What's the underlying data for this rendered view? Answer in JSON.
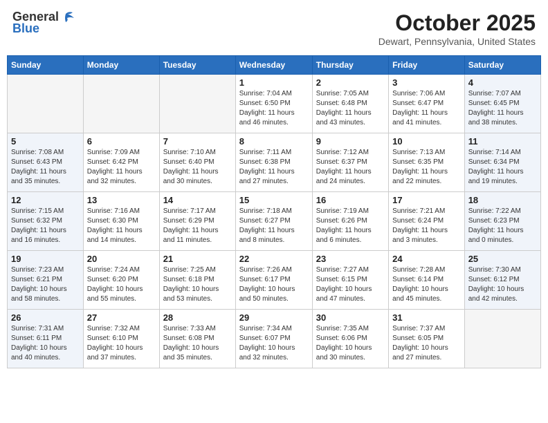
{
  "header": {
    "logo_general": "General",
    "logo_blue": "Blue",
    "month_title": "October 2025",
    "location": "Dewart, Pennsylvania, United States"
  },
  "days_of_week": [
    "Sunday",
    "Monday",
    "Tuesday",
    "Wednesday",
    "Thursday",
    "Friday",
    "Saturday"
  ],
  "weeks": [
    [
      {
        "day": "",
        "info": ""
      },
      {
        "day": "",
        "info": ""
      },
      {
        "day": "",
        "info": ""
      },
      {
        "day": "1",
        "info": "Sunrise: 7:04 AM\nSunset: 6:50 PM\nDaylight: 11 hours\nand 46 minutes."
      },
      {
        "day": "2",
        "info": "Sunrise: 7:05 AM\nSunset: 6:48 PM\nDaylight: 11 hours\nand 43 minutes."
      },
      {
        "day": "3",
        "info": "Sunrise: 7:06 AM\nSunset: 6:47 PM\nDaylight: 11 hours\nand 41 minutes."
      },
      {
        "day": "4",
        "info": "Sunrise: 7:07 AM\nSunset: 6:45 PM\nDaylight: 11 hours\nand 38 minutes."
      }
    ],
    [
      {
        "day": "5",
        "info": "Sunrise: 7:08 AM\nSunset: 6:43 PM\nDaylight: 11 hours\nand 35 minutes."
      },
      {
        "day": "6",
        "info": "Sunrise: 7:09 AM\nSunset: 6:42 PM\nDaylight: 11 hours\nand 32 minutes."
      },
      {
        "day": "7",
        "info": "Sunrise: 7:10 AM\nSunset: 6:40 PM\nDaylight: 11 hours\nand 30 minutes."
      },
      {
        "day": "8",
        "info": "Sunrise: 7:11 AM\nSunset: 6:38 PM\nDaylight: 11 hours\nand 27 minutes."
      },
      {
        "day": "9",
        "info": "Sunrise: 7:12 AM\nSunset: 6:37 PM\nDaylight: 11 hours\nand 24 minutes."
      },
      {
        "day": "10",
        "info": "Sunrise: 7:13 AM\nSunset: 6:35 PM\nDaylight: 11 hours\nand 22 minutes."
      },
      {
        "day": "11",
        "info": "Sunrise: 7:14 AM\nSunset: 6:34 PM\nDaylight: 11 hours\nand 19 minutes."
      }
    ],
    [
      {
        "day": "12",
        "info": "Sunrise: 7:15 AM\nSunset: 6:32 PM\nDaylight: 11 hours\nand 16 minutes."
      },
      {
        "day": "13",
        "info": "Sunrise: 7:16 AM\nSunset: 6:30 PM\nDaylight: 11 hours\nand 14 minutes."
      },
      {
        "day": "14",
        "info": "Sunrise: 7:17 AM\nSunset: 6:29 PM\nDaylight: 11 hours\nand 11 minutes."
      },
      {
        "day": "15",
        "info": "Sunrise: 7:18 AM\nSunset: 6:27 PM\nDaylight: 11 hours\nand 8 minutes."
      },
      {
        "day": "16",
        "info": "Sunrise: 7:19 AM\nSunset: 6:26 PM\nDaylight: 11 hours\nand 6 minutes."
      },
      {
        "day": "17",
        "info": "Sunrise: 7:21 AM\nSunset: 6:24 PM\nDaylight: 11 hours\nand 3 minutes."
      },
      {
        "day": "18",
        "info": "Sunrise: 7:22 AM\nSunset: 6:23 PM\nDaylight: 11 hours\nand 0 minutes."
      }
    ],
    [
      {
        "day": "19",
        "info": "Sunrise: 7:23 AM\nSunset: 6:21 PM\nDaylight: 10 hours\nand 58 minutes."
      },
      {
        "day": "20",
        "info": "Sunrise: 7:24 AM\nSunset: 6:20 PM\nDaylight: 10 hours\nand 55 minutes."
      },
      {
        "day": "21",
        "info": "Sunrise: 7:25 AM\nSunset: 6:18 PM\nDaylight: 10 hours\nand 53 minutes."
      },
      {
        "day": "22",
        "info": "Sunrise: 7:26 AM\nSunset: 6:17 PM\nDaylight: 10 hours\nand 50 minutes."
      },
      {
        "day": "23",
        "info": "Sunrise: 7:27 AM\nSunset: 6:15 PM\nDaylight: 10 hours\nand 47 minutes."
      },
      {
        "day": "24",
        "info": "Sunrise: 7:28 AM\nSunset: 6:14 PM\nDaylight: 10 hours\nand 45 minutes."
      },
      {
        "day": "25",
        "info": "Sunrise: 7:30 AM\nSunset: 6:12 PM\nDaylight: 10 hours\nand 42 minutes."
      }
    ],
    [
      {
        "day": "26",
        "info": "Sunrise: 7:31 AM\nSunset: 6:11 PM\nDaylight: 10 hours\nand 40 minutes."
      },
      {
        "day": "27",
        "info": "Sunrise: 7:32 AM\nSunset: 6:10 PM\nDaylight: 10 hours\nand 37 minutes."
      },
      {
        "day": "28",
        "info": "Sunrise: 7:33 AM\nSunset: 6:08 PM\nDaylight: 10 hours\nand 35 minutes."
      },
      {
        "day": "29",
        "info": "Sunrise: 7:34 AM\nSunset: 6:07 PM\nDaylight: 10 hours\nand 32 minutes."
      },
      {
        "day": "30",
        "info": "Sunrise: 7:35 AM\nSunset: 6:06 PM\nDaylight: 10 hours\nand 30 minutes."
      },
      {
        "day": "31",
        "info": "Sunrise: 7:37 AM\nSunset: 6:05 PM\nDaylight: 10 hours\nand 27 minutes."
      },
      {
        "day": "",
        "info": ""
      }
    ]
  ]
}
